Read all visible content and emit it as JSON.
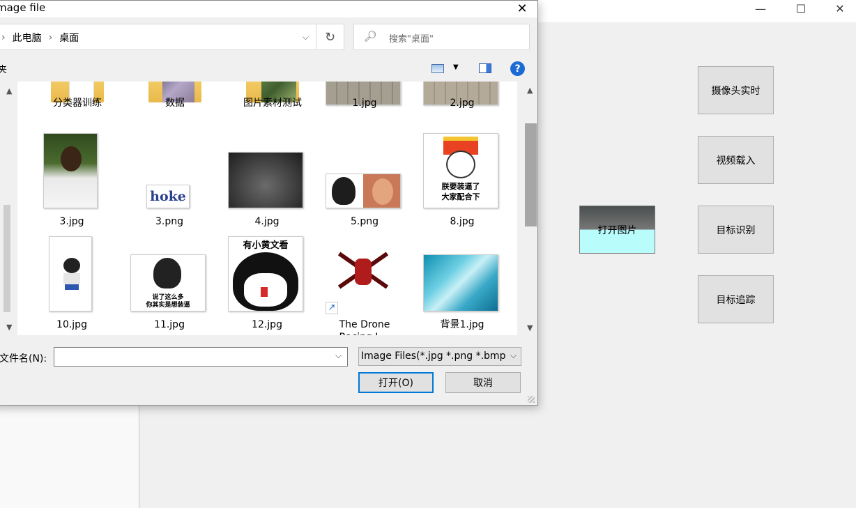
{
  "app": {
    "window_controls": {
      "minimize": "—",
      "maximize": "☐",
      "close": "✕"
    },
    "buttons": {
      "camera": "摄像头实时",
      "video": "视频载入",
      "open_image": "打开图片",
      "detect": "目标识别",
      "track": "目标追踪"
    }
  },
  "dialog": {
    "title": "mage file",
    "close": "✕",
    "breadcrumb": [
      "此电脑",
      "桌面"
    ],
    "breadcrumb_sep": "›",
    "search_placeholder": "搜索\"桌面\"",
    "toolbar_partial": "夹",
    "help": "?",
    "files": [
      {
        "name": "分类器训练",
        "type": "folder"
      },
      {
        "name": "数据",
        "type": "folder"
      },
      {
        "name": "图片素材测试",
        "type": "folder"
      },
      {
        "name": "1.jpg",
        "type": "image"
      },
      {
        "name": "2.jpg",
        "type": "image"
      },
      {
        "name": "3.jpg",
        "type": "image"
      },
      {
        "name": "3.png",
        "type": "image",
        "text": "hoke"
      },
      {
        "name": "4.jpg",
        "type": "image"
      },
      {
        "name": "5.png",
        "type": "image"
      },
      {
        "name": "8.jpg",
        "type": "image",
        "text": "朕要装逼了\n大家配合下"
      },
      {
        "name": "10.jpg",
        "type": "image"
      },
      {
        "name": "11.jpg",
        "type": "image",
        "text": "说了这么多\n你其实是想装逼"
      },
      {
        "name": "12.jpg",
        "type": "image",
        "text": "有小黄文看"
      },
      {
        "name": "The Drone\nRacing L...",
        "type": "shortcut"
      },
      {
        "name": "背景1.jpg",
        "type": "image"
      }
    ],
    "filename_label": "文件名(N):",
    "filename_value": "",
    "filter": "Image Files(*.jpg *.png *.bmp",
    "open_button": "打开(O)",
    "cancel_button": "取消"
  },
  "colors": {
    "accent": "#0078d7",
    "open_image_top": "#4a4f4f",
    "open_image_bottom": "#b9fcfc",
    "help": "#1c6bd4"
  }
}
